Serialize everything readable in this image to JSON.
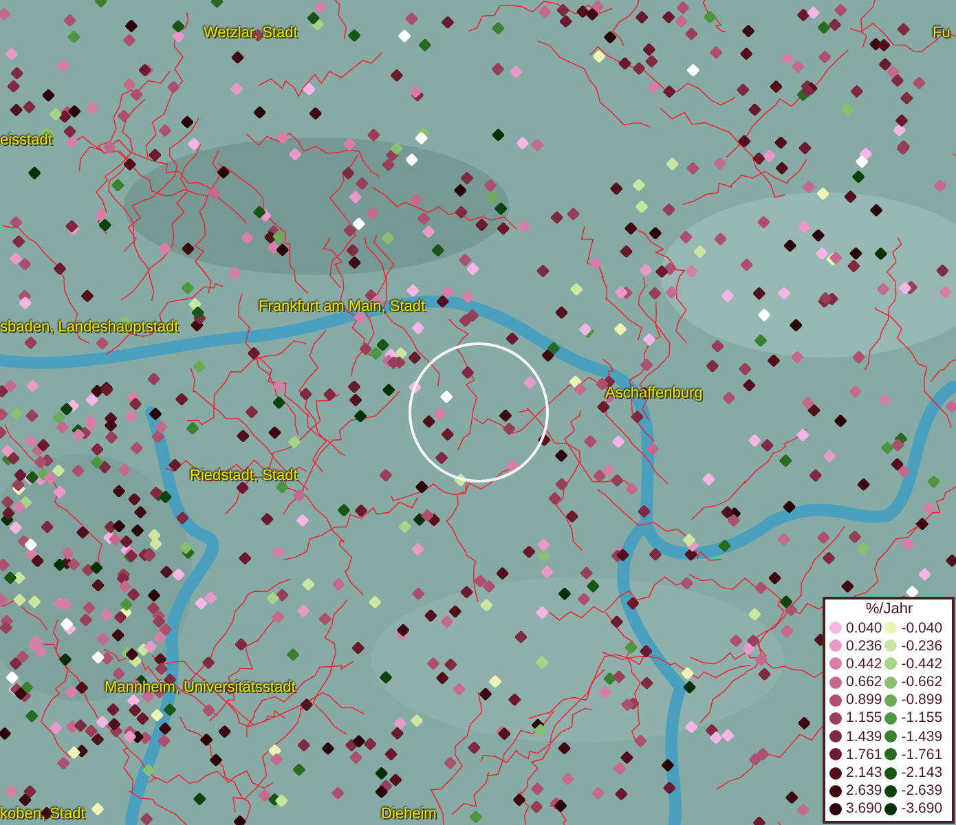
{
  "map": {
    "places": [
      {
        "name": "Wetzlar, Stadt"
      },
      {
        "name": "Fu"
      },
      {
        "name": "eisstadt"
      },
      {
        "name": "sbaden, Landeshauptstadt"
      },
      {
        "name": "Frankfurt am Main, Stadt"
      },
      {
        "name": "Aschaffenburg"
      },
      {
        "name": "Riedstadt, Stadt"
      },
      {
        "name": "Mannheim, Universitätsstadt"
      },
      {
        "name": "koben, Stadt"
      },
      {
        "name": "Dieheim"
      }
    ]
  },
  "legend": {
    "title": "%/Jahr",
    "positive": [
      {
        "label": "0.040",
        "color": "#f5b6e6"
      },
      {
        "label": "0.236",
        "color": "#e79ac8"
      },
      {
        "label": "0.442",
        "color": "#d67fa8"
      },
      {
        "label": "0.662",
        "color": "#c46a8c"
      },
      {
        "label": "0.899",
        "color": "#ad5070"
      },
      {
        "label": "1.155",
        "color": "#973e58"
      },
      {
        "label": "1.439",
        "color": "#7f2a40"
      },
      {
        "label": "1.761",
        "color": "#6a1a2c"
      },
      {
        "label": "2.143",
        "color": "#52101c"
      },
      {
        "label": "2.639",
        "color": "#3e0810"
      },
      {
        "label": "3.690",
        "color": "#2a0308"
      }
    ],
    "negative": [
      {
        "label": "-0.040",
        "color": "#eef5b4"
      },
      {
        "label": "-0.236",
        "color": "#cbe6a0"
      },
      {
        "label": "-0.442",
        "color": "#a8d488"
      },
      {
        "label": "-0.662",
        "color": "#88c070"
      },
      {
        "label": "-0.899",
        "color": "#6aaa58"
      },
      {
        "label": "-1.155",
        "color": "#4e9640"
      },
      {
        "label": "-1.439",
        "color": "#3a8030"
      },
      {
        "label": "-1.761",
        "color": "#286a22"
      },
      {
        "label": "-2.143",
        "color": "#185516"
      },
      {
        "label": "-2.639",
        "color": "#0c420c"
      },
      {
        "label": "-3.690",
        "color": "#053005"
      }
    ]
  }
}
